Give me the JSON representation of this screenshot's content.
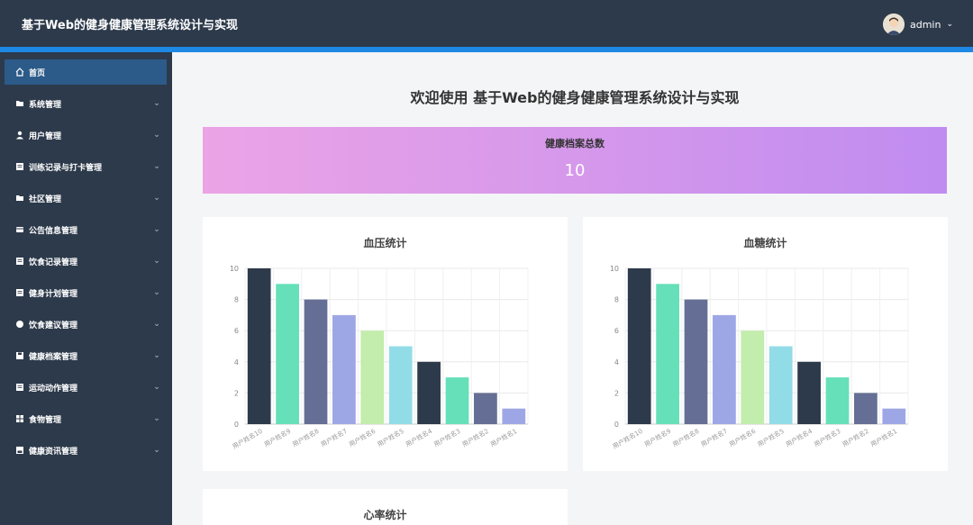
{
  "header": {
    "title": "基于Web的健身健康管理系统设计与实现",
    "user": "admin"
  },
  "sidebar": {
    "items": [
      {
        "label": "首页",
        "icon": "home-icon",
        "active": true
      },
      {
        "label": "系统管理",
        "icon": "folder-icon"
      },
      {
        "label": "用户管理",
        "icon": "user-icon"
      },
      {
        "label": "训练记录与打卡管理",
        "icon": "list-icon"
      },
      {
        "label": "社区管理",
        "icon": "folder-icon"
      },
      {
        "label": "公告信息管理",
        "icon": "card-icon"
      },
      {
        "label": "饮食记录管理",
        "icon": "list-icon"
      },
      {
        "label": "健身计划管理",
        "icon": "list-icon"
      },
      {
        "label": "饮食建议管理",
        "icon": "circle-icon"
      },
      {
        "label": "健康档案管理",
        "icon": "save-icon"
      },
      {
        "label": "运动动作管理",
        "icon": "list-icon"
      },
      {
        "label": "食物管理",
        "icon": "grid-icon"
      },
      {
        "label": "健康资讯管理",
        "icon": "save-icon"
      }
    ]
  },
  "main": {
    "welcome": "欢迎使用 基于Web的健身健康管理系统设计与实现",
    "total": {
      "label": "健康档案总数",
      "value": "10"
    }
  },
  "colors": {
    "palette": [
      "#2d3a4b",
      "#66e0b8",
      "#656f95",
      "#9ea7e6",
      "#c2edac",
      "#92dce8"
    ]
  },
  "chart_data": [
    {
      "type": "bar",
      "title": "血压统计",
      "categories": [
        "用户姓名10",
        "用户姓名9",
        "用户姓名8",
        "用户姓名7",
        "用户姓名6",
        "用户姓名5",
        "用户姓名4",
        "用户姓名3",
        "用户姓名2",
        "用户姓名1"
      ],
      "values": [
        10,
        9,
        8,
        7,
        6,
        5,
        4,
        3,
        2,
        1
      ],
      "ylim": [
        0,
        10
      ],
      "yticks": [
        0,
        2,
        4,
        6,
        8,
        10
      ],
      "grid": true
    },
    {
      "type": "bar",
      "title": "血糖统计",
      "categories": [
        "用户姓名10",
        "用户姓名9",
        "用户姓名8",
        "用户姓名7",
        "用户姓名6",
        "用户姓名5",
        "用户姓名4",
        "用户姓名3",
        "用户姓名2",
        "用户姓名1"
      ],
      "values": [
        10,
        9,
        8,
        7,
        6,
        5,
        4,
        3,
        2,
        1
      ],
      "ylim": [
        0,
        10
      ],
      "yticks": [
        0,
        2,
        4,
        6,
        8,
        10
      ],
      "grid": true
    },
    {
      "type": "bar",
      "title": "心率统计",
      "categories": [],
      "values": []
    }
  ]
}
